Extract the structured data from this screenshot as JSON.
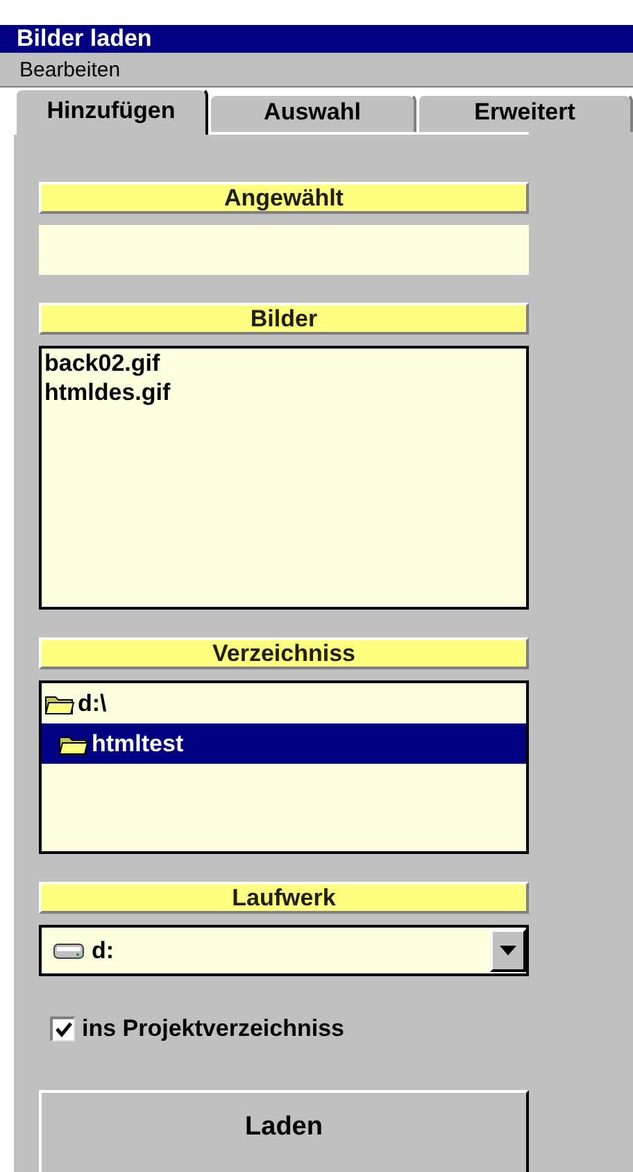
{
  "window": {
    "title": "Bilder laden"
  },
  "menu": [
    "Bearbeiten"
  ],
  "tabs": [
    {
      "label": "Hinzufügen",
      "selected": true
    },
    {
      "label": "Auswahl",
      "selected": false
    },
    {
      "label": "Erweitert",
      "selected": false
    }
  ],
  "selected_image": {
    "heading": "Angewählt"
  },
  "images": {
    "heading": "Bilder",
    "items": [
      {
        "label": "back02.gif",
        "selected": false
      },
      {
        "label": "htmldes.gif",
        "selected": false
      }
    ]
  },
  "directory": {
    "heading": "Verzeichniss",
    "items": [
      {
        "label": "d:\\",
        "selected": false,
        "children": [
          {
            "label": "htmltest",
            "selected": true
          }
        ]
      }
    ]
  },
  "drive": {
    "heading": "Laufwerk",
    "value": "d:"
  },
  "copy_to_project": {
    "label": "ins Projektverzeichniss",
    "checked": true
  },
  "load_button": "Laden"
}
